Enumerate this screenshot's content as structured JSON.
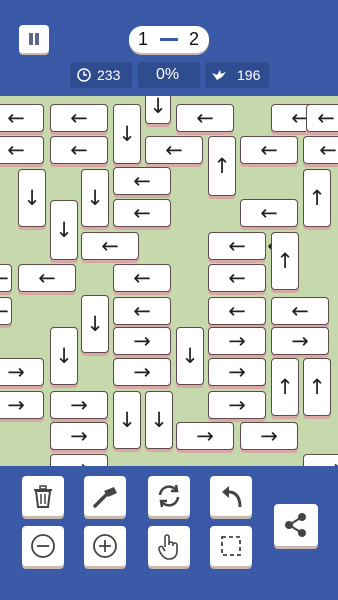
{
  "header": {
    "level_from": "1",
    "level_to": "2",
    "timer_value": "233",
    "progress_value": "0%",
    "moves_value": "196"
  },
  "icons": {
    "pause": "pause-icon",
    "timer": "clock-icon",
    "moves": "bird-icon"
  },
  "board": {
    "background_color": "#c5d9ad",
    "tiles": [
      {
        "dir": "left"
      },
      {
        "dir": "left"
      },
      {
        "dir": "down"
      },
      {
        "dir": "left"
      },
      {
        "dir": "left"
      },
      {
        "dir": "left"
      },
      {
        "dir": "left"
      },
      {
        "dir": "left"
      },
      {
        "dir": "down"
      },
      {
        "dir": "left"
      },
      {
        "dir": "up"
      },
      {
        "dir": "left"
      },
      {
        "dir": "left"
      },
      {
        "dir": "down"
      },
      {
        "dir": "down"
      },
      {
        "dir": "left"
      },
      {
        "dir": "left"
      },
      {
        "dir": "up"
      },
      {
        "dir": "left"
      },
      {
        "dir": "down"
      },
      {
        "dir": "left"
      },
      {
        "dir": "left"
      },
      {
        "dir": "left"
      },
      {
        "dir": "up"
      },
      {
        "dir": "left"
      },
      {
        "dir": "left"
      },
      {
        "dir": "left"
      },
      {
        "dir": "left"
      },
      {
        "dir": "left"
      },
      {
        "dir": "down"
      },
      {
        "dir": "left"
      },
      {
        "dir": "left"
      },
      {
        "dir": "left"
      },
      {
        "dir": "down"
      },
      {
        "dir": "right"
      },
      {
        "dir": "down"
      },
      {
        "dir": "right"
      },
      {
        "dir": "right"
      },
      {
        "dir": "right"
      },
      {
        "dir": "right"
      },
      {
        "dir": "right"
      },
      {
        "dir": "up"
      },
      {
        "dir": "up"
      },
      {
        "dir": "right"
      },
      {
        "dir": "right"
      },
      {
        "dir": "down"
      },
      {
        "dir": "down"
      },
      {
        "dir": "right"
      },
      {
        "dir": "right"
      },
      {
        "dir": "right"
      },
      {
        "dir": "right"
      },
      {
        "dir": "right"
      },
      {
        "dir": "right"
      }
    ]
  },
  "toolbar": {
    "buttons": [
      {
        "icon": "trash-icon"
      },
      {
        "icon": "hammer-icon"
      },
      {
        "icon": "shuffle-icon"
      },
      {
        "icon": "undo-icon"
      },
      {
        "icon": "zoom-out-icon"
      },
      {
        "icon": "zoom-in-icon"
      },
      {
        "icon": "hand-pointer-icon"
      },
      {
        "icon": "select-frame-icon"
      }
    ],
    "share_icon": "share-icon"
  }
}
